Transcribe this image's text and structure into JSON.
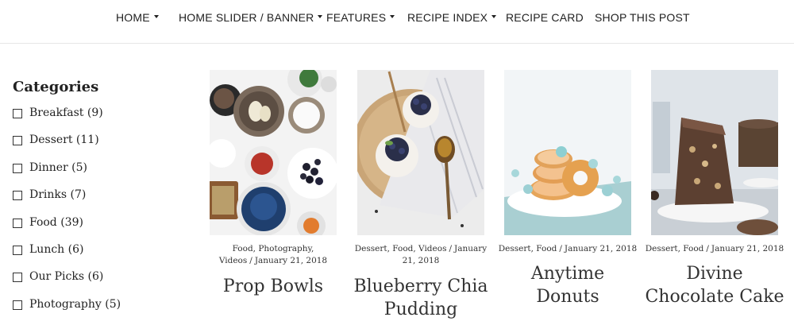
{
  "nav": {
    "items": [
      {
        "label": "HOME",
        "dropdown": true
      },
      {
        "label": "HOME SLIDER / BANNER",
        "dropdown": true
      },
      {
        "label": "FEATURES",
        "dropdown": true
      },
      {
        "label": "RECIPE INDEX",
        "dropdown": true
      },
      {
        "label": "RECIPE CARD",
        "dropdown": false
      },
      {
        "label": "SHOP THIS POST",
        "dropdown": false
      }
    ]
  },
  "sidebar": {
    "title": "Categories",
    "categories": [
      {
        "label": "Breakfast (9)",
        "checked": false
      },
      {
        "label": "Dessert (11)",
        "checked": false
      },
      {
        "label": "Dinner (5)",
        "checked": false
      },
      {
        "label": "Drinks (7)",
        "checked": false
      },
      {
        "label": "Food (39)",
        "checked": false
      },
      {
        "label": "Lunch (6)",
        "checked": false
      },
      {
        "label": "Our Picks (6)",
        "checked": false
      },
      {
        "label": "Photography (5)",
        "checked": false
      }
    ]
  },
  "posts": [
    {
      "categories": "Food, Photography, Videos",
      "separator": "/",
      "date": "January 21, 2018",
      "title_lines": [
        "Prop Bowls"
      ]
    },
    {
      "categories": "Dessert, Food, Videos",
      "separator": "/",
      "date": "January 21, 2018",
      "title_lines": [
        "Blueberry Chia",
        "Pudding"
      ]
    },
    {
      "categories": "Dessert, Food",
      "separator": "/",
      "date": "January 21, 2018",
      "title_lines": [
        "Anytime",
        "Donuts"
      ]
    },
    {
      "categories": "Dessert, Food",
      "separator": "/",
      "date": "January 21, 2018",
      "title_lines": [
        "Divine",
        "Chocolate Cake"
      ]
    }
  ],
  "colors": {
    "text": "#222222",
    "divider": "#e6e6e6",
    "background": "#ffffff"
  }
}
